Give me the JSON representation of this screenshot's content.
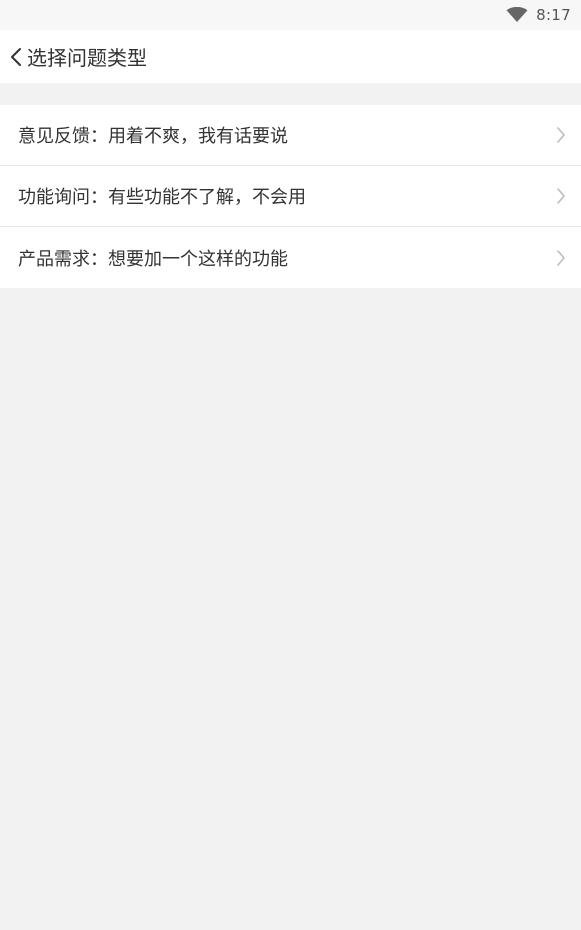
{
  "status_bar": {
    "time": "8:17",
    "wifi_icon": "wifi-icon"
  },
  "header": {
    "title": "选择问题类型",
    "back_icon": "chevron-left-icon"
  },
  "list": {
    "items": [
      {
        "label": "意见反馈：用着不爽，我有话要说",
        "icon": "chevron-right-icon"
      },
      {
        "label": "功能询问：有些功能不了解，不会用",
        "icon": "chevron-right-icon"
      },
      {
        "label": "产品需求：想要加一个这样的功能",
        "icon": "chevron-right-icon"
      }
    ]
  },
  "colors": {
    "background": "#f2f2f2",
    "surface": "#ffffff",
    "text": "#333333",
    "divider": "#e6e6e6",
    "chevron": "#bdbdbd"
  }
}
